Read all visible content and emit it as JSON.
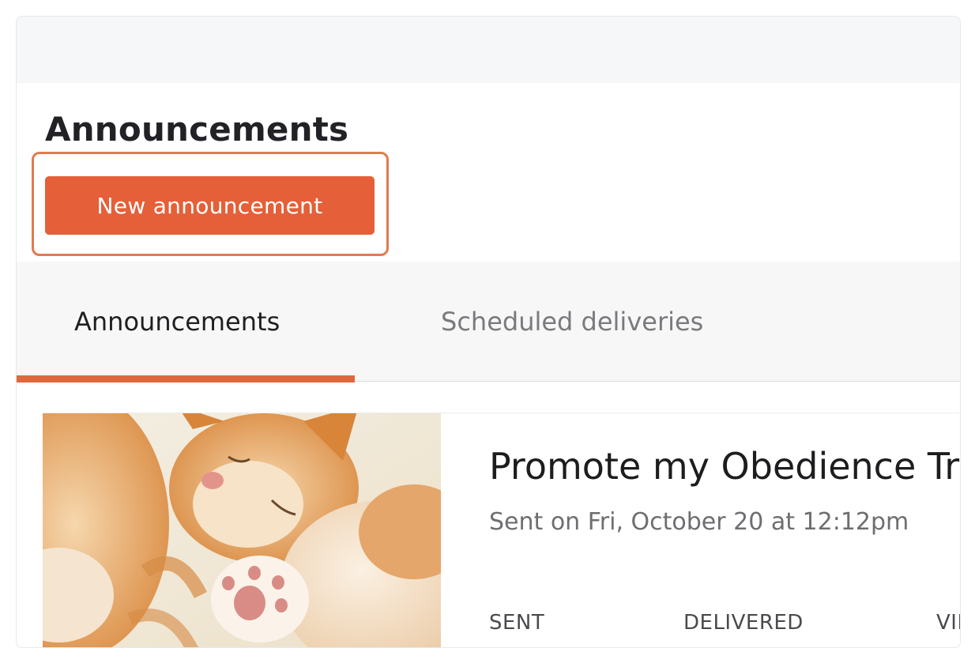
{
  "page": {
    "title": "Announcements",
    "new_button_label": "New announcement"
  },
  "tabs": [
    {
      "label": "Announcements",
      "active": true
    },
    {
      "label": "Scheduled deliveries",
      "active": false
    }
  ],
  "announcement": {
    "title": "Promote my Obedience Tra",
    "sent_text": "Sent on Fri, October 20 at 12:12pm",
    "image": "kitten-photo",
    "stats": [
      {
        "label": "SENT"
      },
      {
        "label": "DELIVERED"
      },
      {
        "label": "VIE"
      }
    ]
  },
  "colors": {
    "accent": "#e55f38",
    "tab_underline": "#e0683f",
    "highlight_border": "#e27a4e"
  }
}
